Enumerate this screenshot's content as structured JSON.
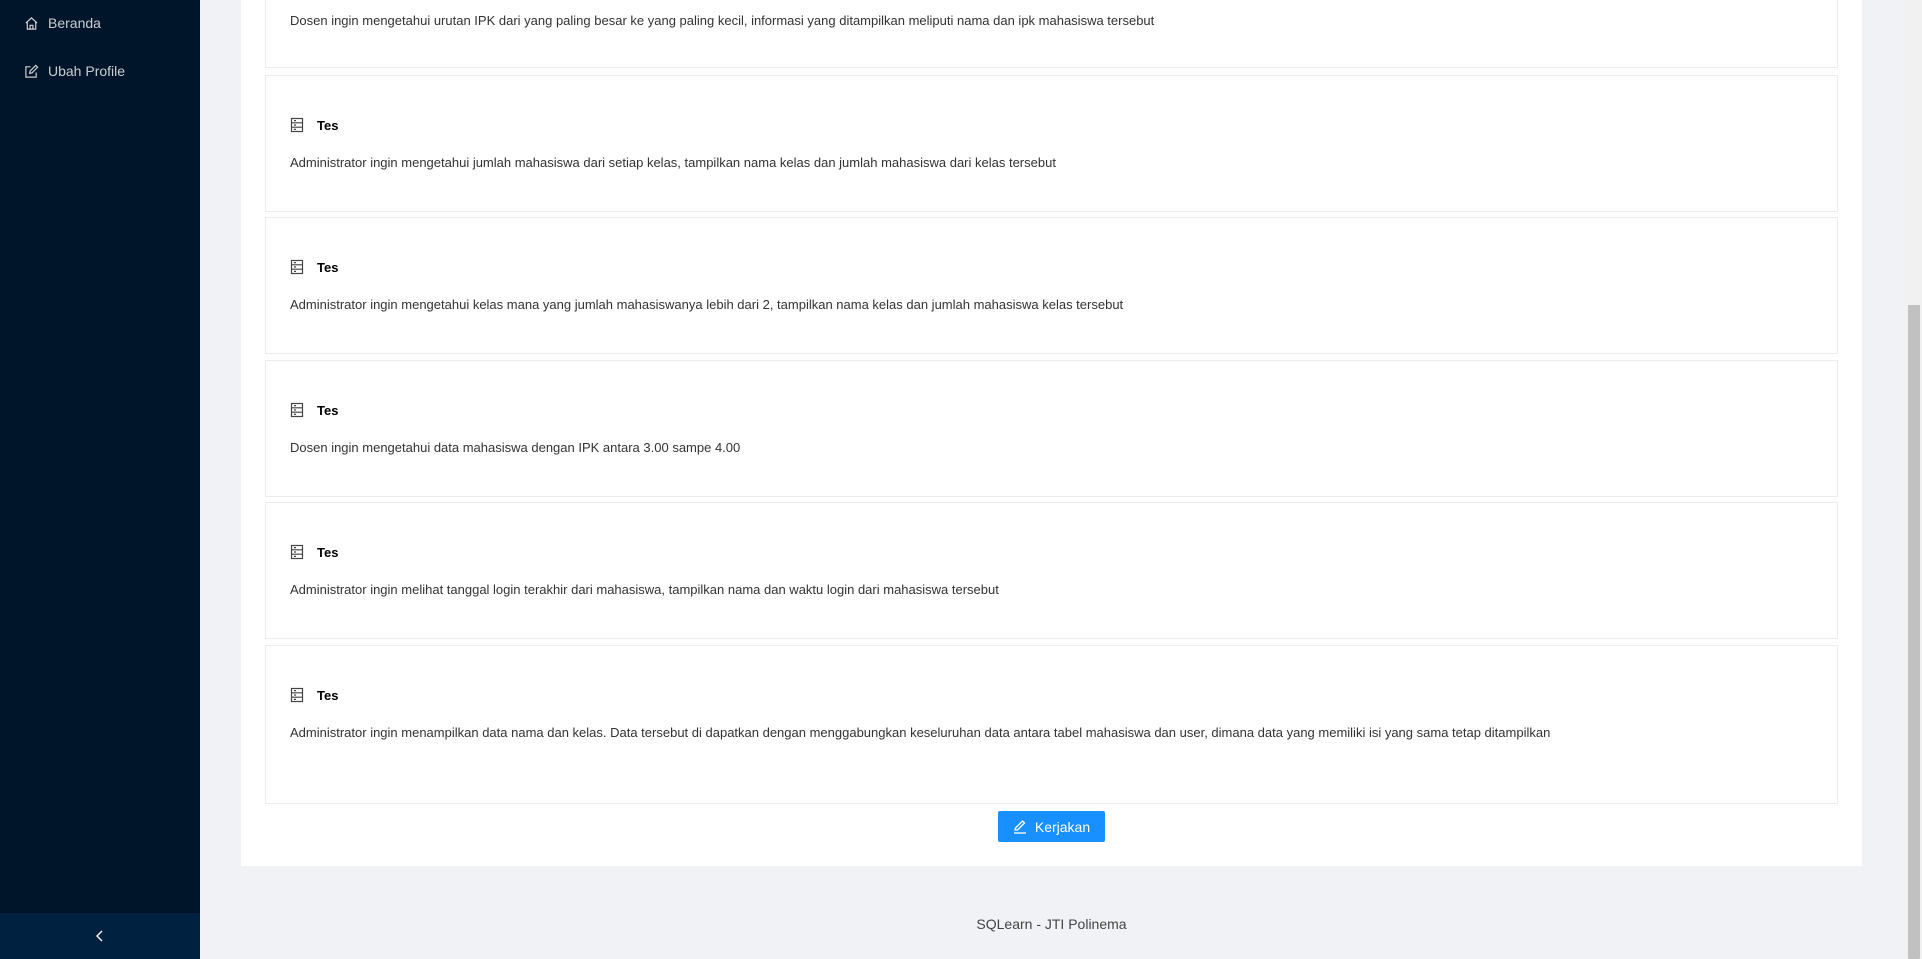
{
  "sidebar": {
    "items": [
      {
        "label": "Beranda",
        "icon": "home-icon"
      },
      {
        "label": "Ubah Profile",
        "icon": "edit-icon"
      }
    ],
    "collapse_icon": "chevron-left-icon"
  },
  "exercises": [
    {
      "title": "",
      "description": "Dosen ingin mengetahui urutan IPK dari yang paling besar ke yang paling kecil, informasi yang ditampilkan meliputi nama dan ipk mahasiswa tersebut"
    },
    {
      "title": "Tes",
      "description": "Administrator ingin mengetahui jumlah mahasiswa dari setiap kelas, tampilkan nama kelas dan jumlah mahasiswa dari kelas tersebut"
    },
    {
      "title": "Tes",
      "description": "Administrator ingin mengetahui kelas mana yang jumlah mahasiswanya lebih dari 2, tampilkan nama kelas dan jumlah mahasiswa kelas tersebut"
    },
    {
      "title": "Tes",
      "description": "Dosen ingin mengetahui data mahasiswa dengan IPK antara 3.00 sampe 4.00"
    },
    {
      "title": "Tes",
      "description": "Administrator ingin melihat tanggal login terakhir dari mahasiswa, tampilkan nama dan waktu login dari mahasiswa tersebut"
    },
    {
      "title": "Tes",
      "description": "Administrator ingin menampilkan data nama dan kelas. Data tersebut di dapatkan dengan menggabungkan keseluruhan data antara tabel mahasiswa dan user, dimana data yang memiliki isi yang sama tetap ditampilkan"
    }
  ],
  "action": {
    "label": "Kerjakan",
    "icon": "edit-icon"
  },
  "footer": {
    "text": "SQLearn - JTI Polinema"
  },
  "colors": {
    "sidebar": "#001529",
    "primary": "#1890ff",
    "background": "#f0f2f5"
  }
}
